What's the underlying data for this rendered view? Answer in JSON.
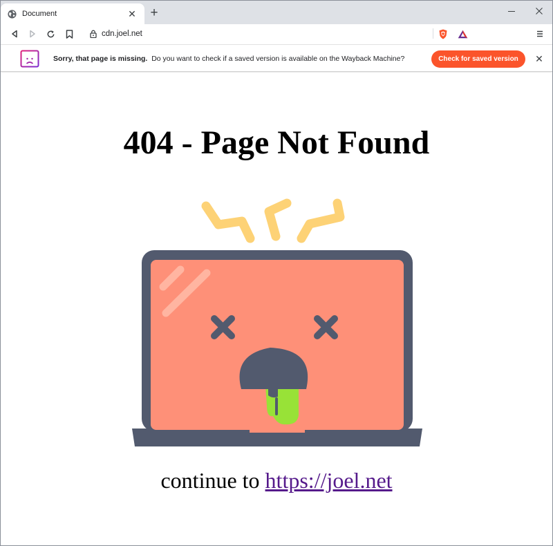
{
  "browser": {
    "tab_title": "Document",
    "new_tab_symbol": "+",
    "tab_close_symbol": "✕",
    "address": "cdn.joel.net",
    "window_controls": [
      "minimize",
      "maximize",
      "close"
    ],
    "icons": [
      "globe-icon",
      "back-icon",
      "forward-icon",
      "reload-icon",
      "bookmark-icon",
      "lock-icon",
      "brave-shields-icon",
      "brave-rewards-icon",
      "menu-icon"
    ]
  },
  "infobar": {
    "title": "Sorry, that page is missing.",
    "message": "Do you want to check if a saved version is available on the Wayback Machine?",
    "button_label": "Check for saved version",
    "close_symbol": "✕",
    "accent_color": "#fb542b",
    "icon": "sad-page-icon"
  },
  "page": {
    "heading": "404 - Page Not Found",
    "continue_text": "continue to",
    "link_text": "https://joel.net",
    "illustration": "broken-laptop-illustration",
    "colors": {
      "screen": "#fe9078",
      "frame": "#525a6e",
      "sparks": "#fdd276",
      "tongue": "#98e237"
    }
  }
}
